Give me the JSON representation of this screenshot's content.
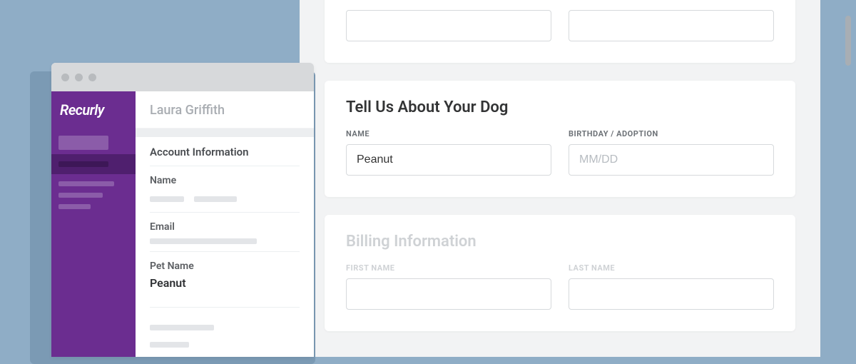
{
  "form": {
    "dog_section": {
      "heading": "Tell Us About Your Dog",
      "name_label": "NAME",
      "name_value": "Peanut",
      "birthday_label": "BIRTHDAY / ADOPTION",
      "birthday_placeholder": "MM/DD"
    },
    "billing_section": {
      "heading": "Billing Information",
      "first_name_label": "FIRST NAME",
      "last_name_label": "LAST NAME"
    }
  },
  "admin": {
    "brand": "Recurly",
    "customer_name": "Laura Griffith",
    "account_info_heading": "Account Information",
    "fields": {
      "name_label": "Name",
      "email_label": "Email",
      "pet_name_label": "Pet Name",
      "pet_name_value": "Peanut"
    }
  }
}
